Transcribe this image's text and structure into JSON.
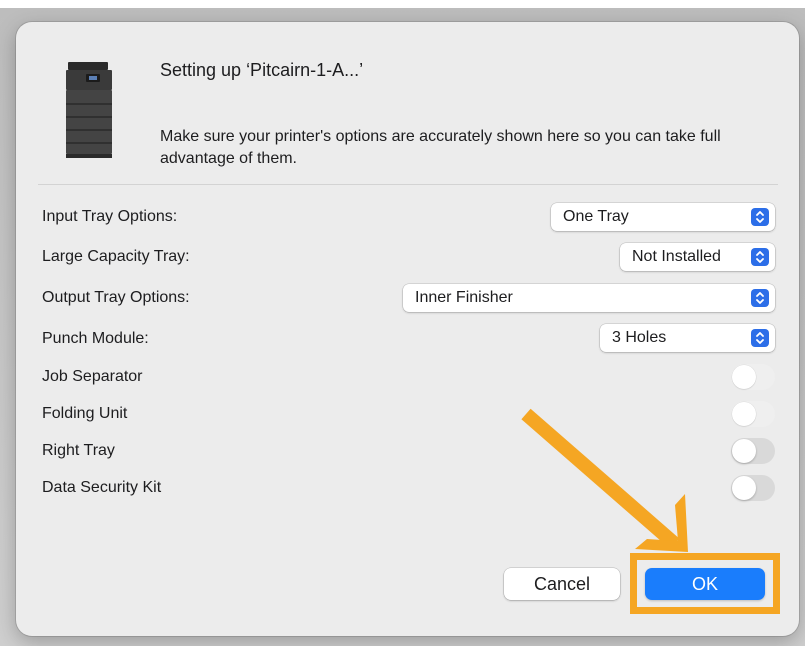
{
  "dialog": {
    "title": "Setting up ‘Pitcairn-1-A...’",
    "description": "Make sure your printer's options are accurately shown here so you can take full advantage of them."
  },
  "options": {
    "input_tray": {
      "label": "Input Tray Options:",
      "value": "One Tray"
    },
    "large_capacity_tray": {
      "label": "Large Capacity Tray:",
      "value": "Not Installed"
    },
    "output_tray": {
      "label": "Output Tray Options:",
      "value": "Inner Finisher"
    },
    "punch_module": {
      "label": "Punch Module:",
      "value": "3 Holes"
    },
    "job_separator": {
      "label": "Job Separator",
      "on": false,
      "enabled": false
    },
    "folding_unit": {
      "label": "Folding Unit",
      "on": false,
      "enabled": false
    },
    "right_tray": {
      "label": "Right Tray",
      "on": false,
      "enabled": true
    },
    "data_security_kit": {
      "label": "Data Security Kit",
      "on": false,
      "enabled": true
    }
  },
  "buttons": {
    "cancel": "Cancel",
    "ok": "OK"
  },
  "colors": {
    "accent": "#1a7dfc",
    "annotation": "#f5a623",
    "popup_chevron": "#2c6ee8"
  },
  "icons": {
    "printer": "printer-icon",
    "popup": "chevron-updown-icon",
    "annotation": "arrow-annotation"
  }
}
